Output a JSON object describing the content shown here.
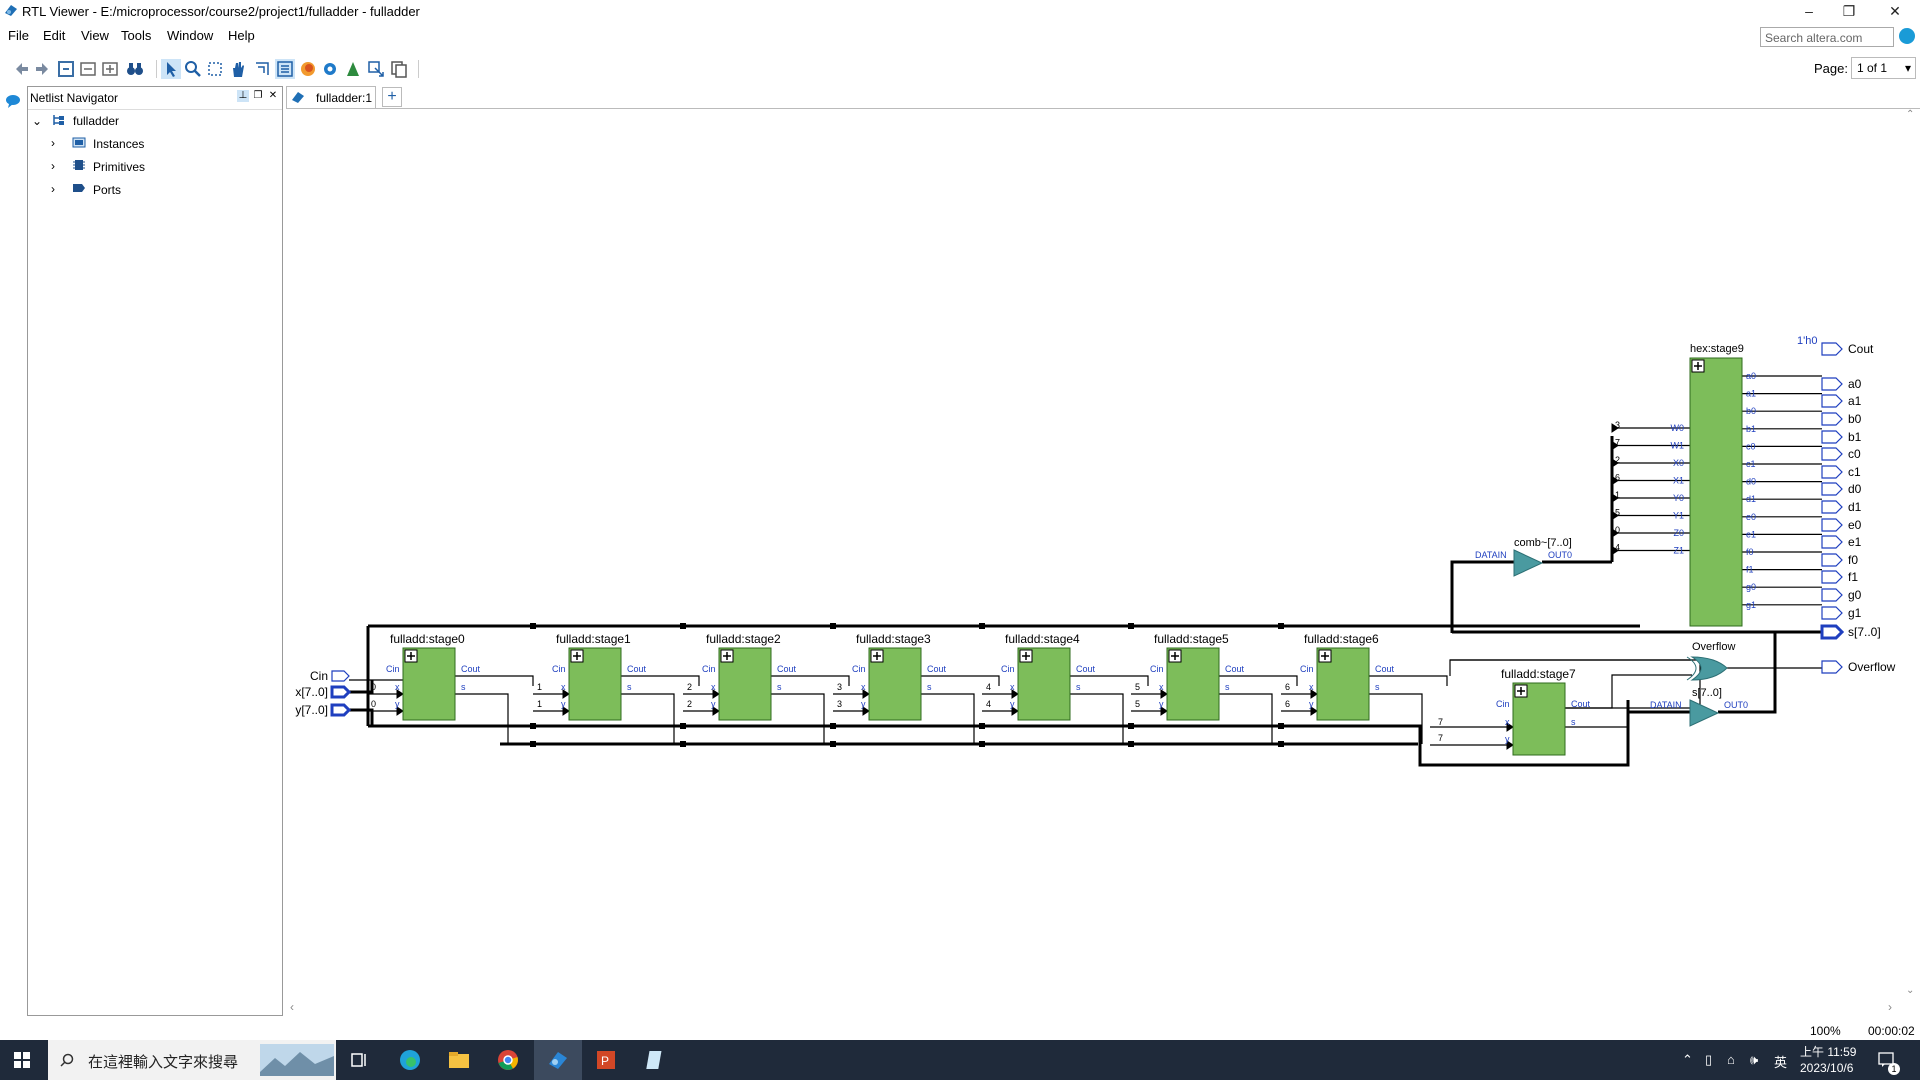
{
  "window": {
    "title": "RTL Viewer - E:/microprocessor/course2/project1/fulladder - fulladder",
    "minimize": "–",
    "maximize": "❐",
    "close": "✕"
  },
  "menu": [
    "File",
    "Edit",
    "View",
    "Tools",
    "Window",
    "Help"
  ],
  "search": {
    "placeholder": "Search altera.com"
  },
  "toolbar": {
    "icons": [
      "back-icon",
      "forward-icon",
      "refresh-icon",
      "collapse-icon",
      "expand-icon",
      "binoculars-icon",
      "select-pointer-icon",
      "zoom-icon",
      "fit-icon",
      "hand-icon",
      "selection-icon",
      "netlist-icon",
      "firefox-icon",
      "gear-icon",
      "hierarchy-icon",
      "export-icon",
      "copy-icon"
    ],
    "page_label": "Page:",
    "page_value": "1 of 1"
  },
  "navigator": {
    "title": "Netlist Navigator",
    "root": "fulladder",
    "items": [
      "Instances",
      "Primitives",
      "Ports"
    ]
  },
  "tab": {
    "label": "fulladder:1",
    "add": "+"
  },
  "schematic": {
    "inputs": [
      "Cin",
      "x[7..0]",
      "y[7..0]"
    ],
    "stages": [
      "fulladd:stage0",
      "fulladd:stage1",
      "fulladd:stage2",
      "fulladd:stage3",
      "fulladd:stage4",
      "fulladd:stage5",
      "fulladd:stage6",
      "fulladd:stage7"
    ],
    "stage_indices": [
      "0",
      "1",
      "2",
      "3",
      "4",
      "5",
      "6",
      "7"
    ],
    "port_cin": "Cin",
    "port_cout": "Cout",
    "port_x": "x",
    "port_y": "y",
    "port_s": "s",
    "hex_name": "hex:stage9",
    "hex_inputs": [
      "W0",
      "W1",
      "X0",
      "X1",
      "Y0",
      "Y1",
      "Z0",
      "Z1"
    ],
    "hex_input_bits": [
      "3",
      "7",
      "2",
      "6",
      "1",
      "5",
      "0",
      "4"
    ],
    "hex_outputs": [
      "a0",
      "a1",
      "b0",
      "b1",
      "c0",
      "c1",
      "d0",
      "d1",
      "e0",
      "e1",
      "f0",
      "f1",
      "g0",
      "g1"
    ],
    "comb_name": "comb~[7..0]",
    "datain": "DATAIN",
    "out0": "OUT0",
    "overflow_gate": "Overflow",
    "s_buf": "s[7..0]",
    "const_label": "1'h0",
    "outputs": [
      "Cout",
      "a0",
      "a1",
      "b0",
      "b1",
      "c0",
      "c1",
      "d0",
      "d1",
      "e0",
      "e1",
      "f0",
      "f1",
      "g0",
      "g1",
      "s[7..0]",
      "Overflow"
    ]
  },
  "status": {
    "zoom": "100%",
    "time": "00:00:02"
  },
  "taskbar": {
    "search_placeholder": "在這裡輸入文字來搜尋",
    "clock_time": "上午 11:59",
    "clock_date": "2023/10/6",
    "ime": "英",
    "notif_count": "1"
  }
}
